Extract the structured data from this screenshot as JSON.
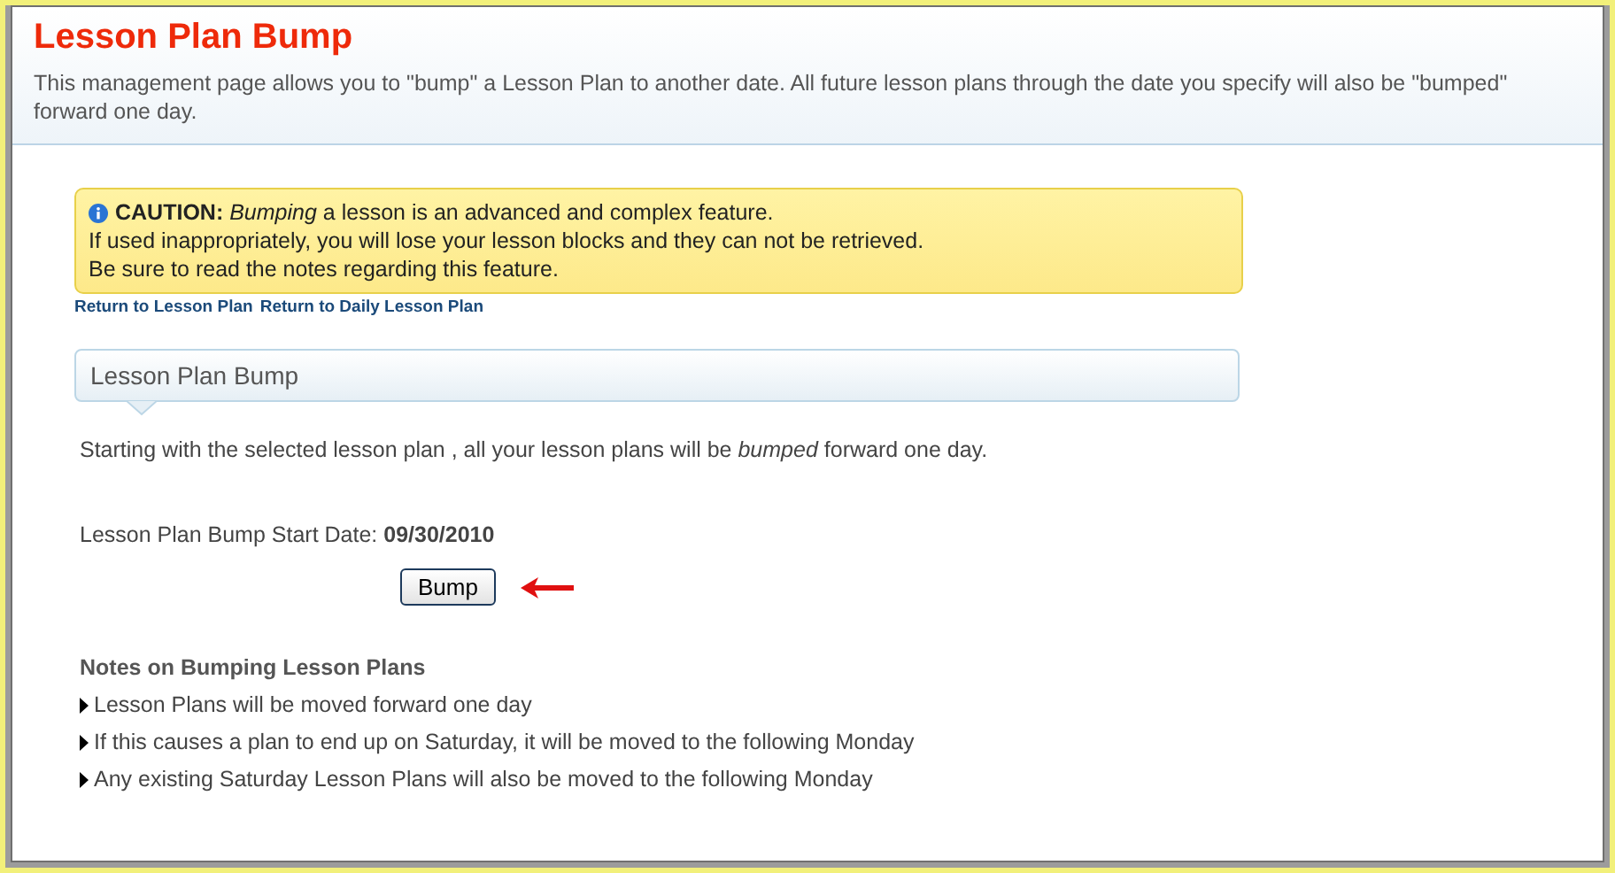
{
  "header": {
    "title": "Lesson Plan Bump",
    "description": "This management page allows you to \"bump\" a Lesson Plan to another date. All future lesson plans through the date you specify will also be \"bumped\" forward one day."
  },
  "caution": {
    "lines": [
      "**CAUTION:** *Bumping* a lesson is an advanced and complex feature.",
      "If used inappropriately, you will lose your lesson blocks and they can not be retrieved.",
      "Be sure to read the notes regarding this feature."
    ]
  },
  "links": [
    "Return to Lesson Plan",
    "Return to Daily Lesson Plan"
  ],
  "section": {
    "title": "Lesson Plan Bump"
  },
  "intro": "Starting with the selected lesson plan , all your lesson plans will be *bumped* forward one day.",
  "start_date": "Lesson Plan Bump Start Date: **09/30/2010**",
  "button": "Bump",
  "notes": {
    "title": "Notes on Bumping Lesson Plans",
    "items": [
      "Lesson Plans will be moved forward one day",
      "If this causes a plan to end up on Saturday, it will be moved to the following Monday",
      "Any existing Saturday Lesson Plans will also be moved to the following Monday"
    ]
  }
}
